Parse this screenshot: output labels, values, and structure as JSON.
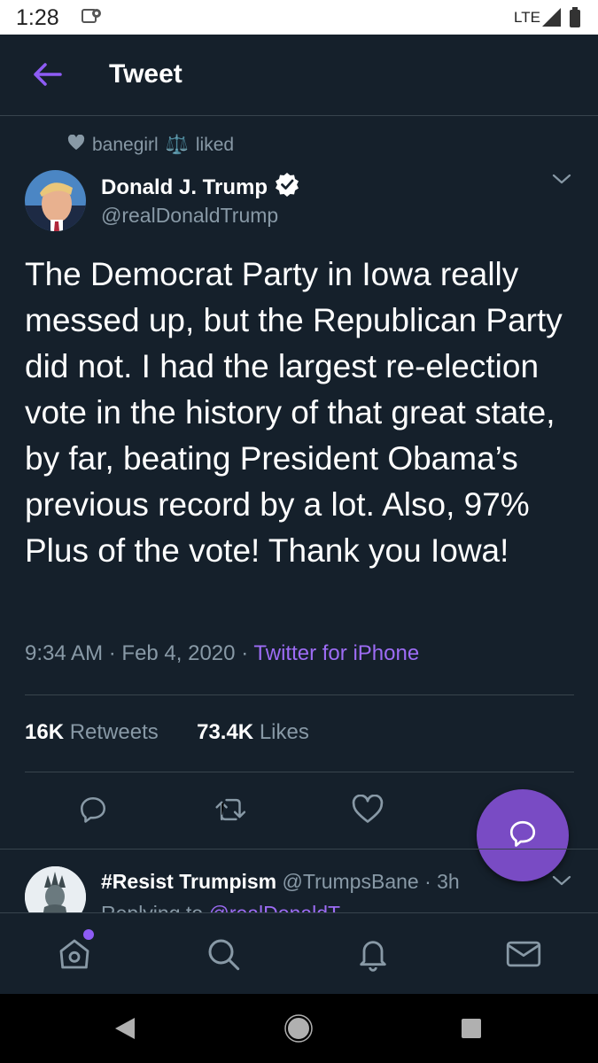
{
  "status_bar": {
    "time": "1:28",
    "network": "LTE"
  },
  "header": {
    "title": "Tweet"
  },
  "social_context": {
    "user": "banegirl",
    "emoji": "⚖️",
    "action": "liked"
  },
  "tweet": {
    "author_name": "Donald J. Trump",
    "author_handle": "@realDonaldTrump",
    "verified": true,
    "text": "The Democrat Party in Iowa really messed up, but the Republican Party did not. I had the largest re-election vote in the history of that great state, by far, beating President Obama’s previous record by a lot. Also, 97% Plus of the vote! Thank you Iowa!",
    "time": "9:34 AM",
    "date": "Feb 4, 2020",
    "separator": "·",
    "source": "Twitter for iPhone",
    "retweets_count": "16K",
    "retweets_label": "Retweets",
    "likes_count": "73.4K",
    "likes_label": "Likes"
  },
  "reply": {
    "name": "#Resist Trumpism",
    "handle": "@TrumpsBane",
    "time": "· 3h",
    "replying_prefix": "Replying to",
    "replying_to": "@realDonaldT..."
  },
  "icons": {
    "back": "back-arrow-icon",
    "verified": "verified-badge-icon",
    "reply": "reply-icon",
    "retweet": "retweet-icon",
    "like": "heart-icon",
    "compose": "compose-reply-icon",
    "home": "home-icon",
    "search": "search-icon",
    "notifications": "bell-icon",
    "messages": "mail-icon"
  },
  "colors": {
    "background": "#15202b",
    "accent": "#794bc4",
    "link": "#9d6cf5",
    "secondary_text": "#8899a6",
    "divider": "#38444d"
  }
}
